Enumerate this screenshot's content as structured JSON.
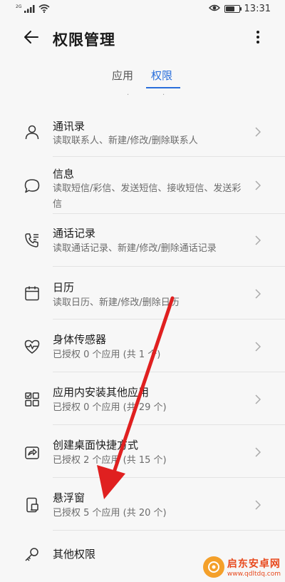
{
  "status_bar": {
    "signal_label": "2G",
    "time": "13:31",
    "battery_level": 0.7
  },
  "header": {
    "title": "权限管理",
    "back_icon": "arrow-left-icon",
    "more_icon": "more-vertical-icon"
  },
  "tabs": [
    {
      "label": "应用",
      "active": false
    },
    {
      "label": "权限",
      "active": true
    }
  ],
  "tab_dots": "·",
  "permissions": [
    {
      "title": "通讯录",
      "desc": "读取联系人、新建/修改/删除联系人",
      "icon": "person-icon"
    },
    {
      "title": "信息",
      "desc": "读取短信/彩信、发送短信、接收短信、发送彩信",
      "icon": "message-bubble-icon"
    },
    {
      "title": "通话记录",
      "desc": "读取通话记录、新建/修改/删除通话记录",
      "icon": "phone-log-icon"
    },
    {
      "title": "日历",
      "desc": "读取日历、新建/修改/删除日历",
      "icon": "calendar-icon"
    },
    {
      "title": "身体传感器",
      "desc": "已授权 0 个应用 (共 1 个)",
      "icon": "heart-rate-icon"
    },
    {
      "title": "应用内安装其他应用",
      "desc": "已授权 0 个应用 (共 29 个)",
      "icon": "app-grid-icon"
    },
    {
      "title": "创建桌面快捷方式",
      "desc": "已授权 2 个应用 (共 15 个)",
      "icon": "shortcut-icon"
    },
    {
      "title": "悬浮窗",
      "desc": "已授权 5 个应用 (共 20 个)",
      "icon": "floating-window-icon"
    },
    {
      "title": "其他权限",
      "desc": "",
      "icon": "key-icon"
    }
  ],
  "watermark": {
    "name": "启东安卓网",
    "url": "www.qdltdq.com"
  },
  "colors": {
    "accent": "#2a6fdb",
    "annotation_arrow": "#e02020"
  }
}
